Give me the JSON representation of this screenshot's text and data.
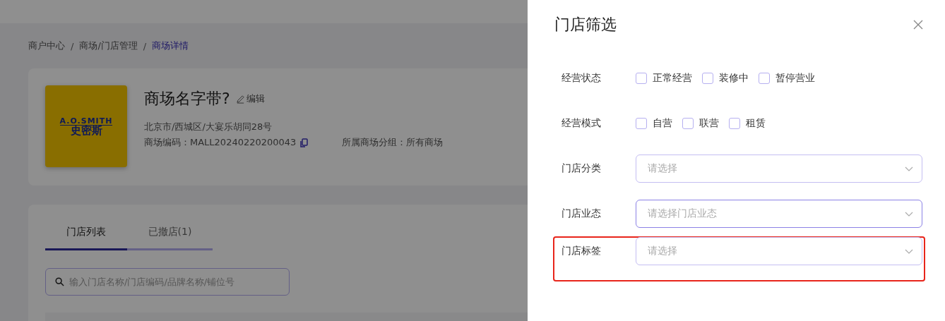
{
  "breadcrumb": [
    {
      "label": "商户中心",
      "selected": false
    },
    {
      "separator": "/",
      "label": "商场/门店管理",
      "selected": false
    },
    {
      "separator": "/",
      "label": "商场详情",
      "selected": true
    }
  ],
  "mall": {
    "logo_lines": [
      "A.O.SMITH",
      "史密斯"
    ],
    "name": "商场名字带?",
    "edit": "编辑",
    "address": "北京市/西城区/大宴乐胡同28号",
    "code_label": "商场编码：",
    "code": "MALL20240220200043",
    "group_label": "所属商场分组：",
    "group": "所有商场"
  },
  "tabs": [
    {
      "label": "门店列表",
      "selected": true
    },
    {
      "label": "已撤店(1)",
      "selected": false
    }
  ],
  "search": {
    "placeholder": "输入门店名称/门店编码/品牌名称/铺位号"
  },
  "drawer": {
    "title": "门店筛选",
    "fields": [
      {
        "kind": "checkboxes",
        "label": "经营状态",
        "highlighted": false,
        "options": [
          {
            "label": "正常经营",
            "checked": false
          },
          {
            "label": "装修中",
            "checked": false
          },
          {
            "label": "暂停营业",
            "checked": false
          }
        ]
      },
      {
        "kind": "checkboxes",
        "label": "经营模式",
        "highlighted": false,
        "options": [
          {
            "label": "自营",
            "checked": false
          },
          {
            "label": "联营",
            "checked": false
          },
          {
            "label": "租赁",
            "checked": false
          }
        ]
      },
      {
        "kind": "select",
        "label": "门店分类",
        "highlighted": false,
        "placeholder": "请选择",
        "focused": false
      },
      {
        "kind": "select",
        "label": "门店业态",
        "highlighted": false,
        "placeholder": "请选择门店业态",
        "focused": true
      },
      {
        "kind": "select",
        "label": "门店标签",
        "highlighted": true,
        "placeholder": "请选择",
        "focused": false
      }
    ]
  }
}
